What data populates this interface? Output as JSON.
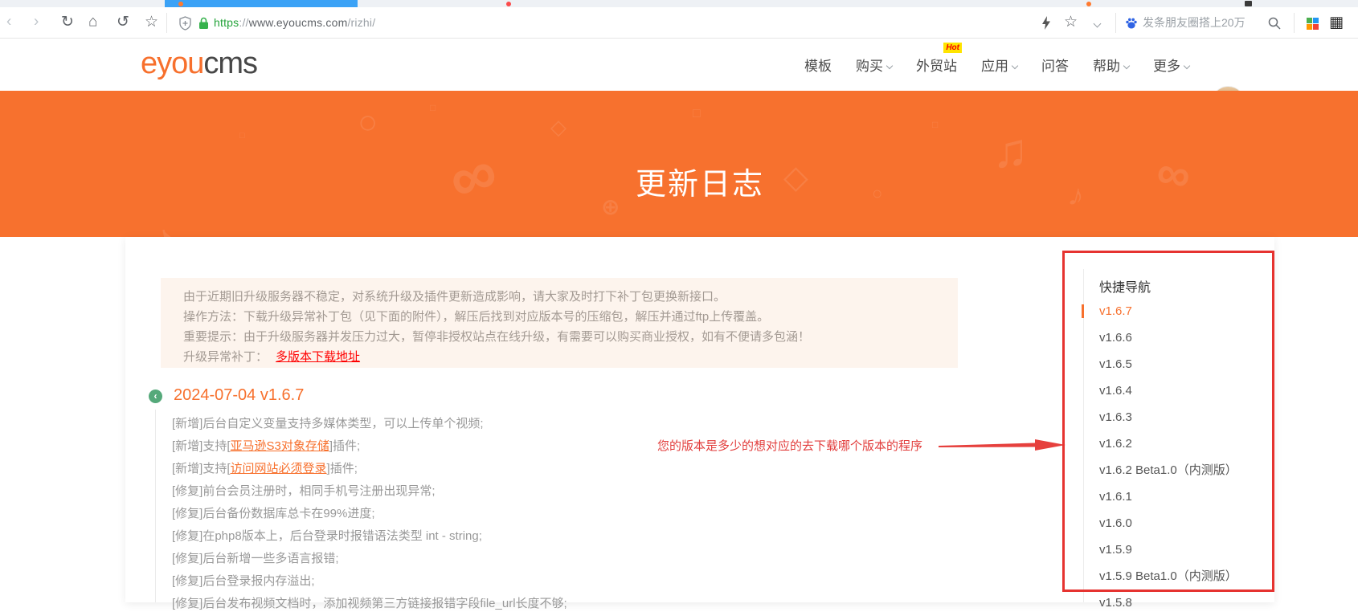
{
  "colors": {
    "accent": "#f7702d",
    "banner_orange": "#f7712e",
    "annotation_red": "#e63330",
    "link_red": "#fe0000",
    "https_green": "#23a339",
    "active_tab_blue": "#3ba2f6",
    "timeline_green": "#55a97a"
  },
  "browser": {
    "toolbar_icons": {
      "back": "‹",
      "forward": "›",
      "refresh": "↻",
      "home": "⌂",
      "undo": "↺",
      "star": "☆",
      "star_right": "☆",
      "qr": "▦"
    },
    "address": {
      "scheme": "https",
      "separator": "://",
      "host": "www.eyoucms.com",
      "path": "/rizhi/"
    },
    "search": {
      "text": "发条朋友圈搭上20万"
    }
  },
  "header": {
    "logo": {
      "part1": "eyou",
      "part2": "cms"
    },
    "nav": [
      {
        "label": "模板"
      },
      {
        "label": "购买"
      },
      {
        "label": "外贸站",
        "badge": "Hot"
      },
      {
        "label": "应用"
      },
      {
        "label": "问答"
      },
      {
        "label": "帮助"
      },
      {
        "label": "更多"
      }
    ]
  },
  "banner": {
    "title": "更新日志"
  },
  "notice": {
    "line1": "由于近期旧升级服务器不稳定，对系统升级及插件更新造成影响，请大家及时打下补丁包更换新接口。",
    "line2": "操作方法：下载升级异常补丁包（见下面的附件），解压后找到对应版本号的压缩包，解压并通过ftp上传覆盖。",
    "line3": "重要提示：由于升级服务器并发压力过大，暂停非授权站点在线升级，有需要可以购买商业授权，如有不便请多包涵！",
    "patch_label": "升级异常补丁：",
    "patch_link": "多版本下载地址"
  },
  "changelog": {
    "heading": "2024-07-04 v1.6.7",
    "items": [
      {
        "text": "[新增]后台自定义变量支持多媒体类型，可以上传单个视频;"
      },
      {
        "before": "[新增]支持[",
        "link": "亚马逊S3对象存储",
        "after": "]插件;"
      },
      {
        "before": "[新增]支持[",
        "link": "访问网站必须登录",
        "after": "]插件;"
      },
      {
        "text": "[修复]前台会员注册时，相同手机号注册出现异常;"
      },
      {
        "text": "[修复]后台备份数据库总卡在99%进度;"
      },
      {
        "text": "[修复]在php8版本上，后台登录时报错语法类型 int - string;"
      },
      {
        "text": "[修复]后台新增一些多语言报错;"
      },
      {
        "text": "[修复]后台登录报内存溢出;"
      },
      {
        "text": "[修复]后台发布视频文档时，添加视频第三方链接报错字段file_url长度不够;"
      }
    ]
  },
  "annotation": {
    "text": "您的版本是多少的想对应的去下载哪个版本的程序"
  },
  "quick_nav": {
    "title": "快捷导航",
    "items": [
      "v1.6.7",
      "v1.6.6",
      "v1.6.5",
      "v1.6.4",
      "v1.6.3",
      "v1.6.2",
      "v1.6.2 Beta1.0（内测版）",
      "v1.6.1",
      "v1.6.0",
      "v1.5.9",
      "v1.5.9 Beta1.0（内测版）",
      "v1.5.8"
    ]
  }
}
